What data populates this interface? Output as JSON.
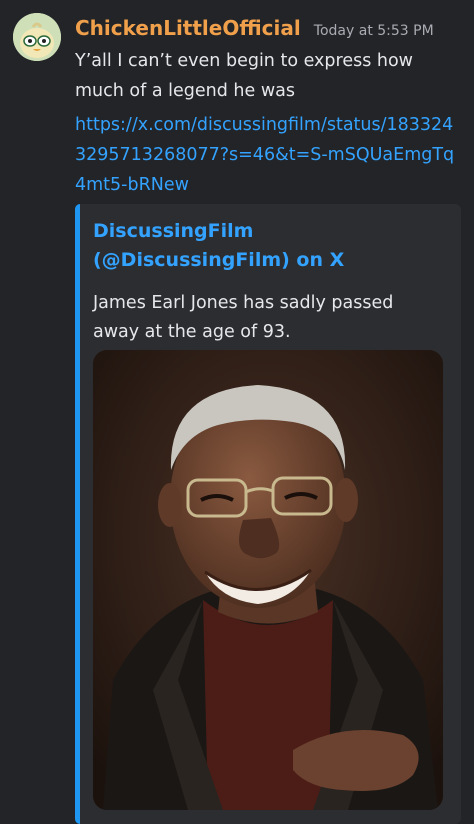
{
  "message": {
    "username": "ChickenLittleOfficial",
    "timestamp": "Today at 5:53 PM",
    "text": "Y’all I can’t even begin to express how much of a legend he was",
    "link": "https://x.com/discussingfilm/status/1833243295713268077?s=46&t=S-mSQUaEmgTq4mt5-bRNew"
  },
  "embed": {
    "author": "DiscussingFilm (@DiscussingFilm) on X",
    "description": "James Earl Jones has sadly passed away at the age of 93."
  },
  "colors": {
    "username": "#f0a04b",
    "link": "#33a3ff",
    "embed_border": "#1f97f2",
    "background": "#232428",
    "embed_background": "#2b2d31"
  }
}
